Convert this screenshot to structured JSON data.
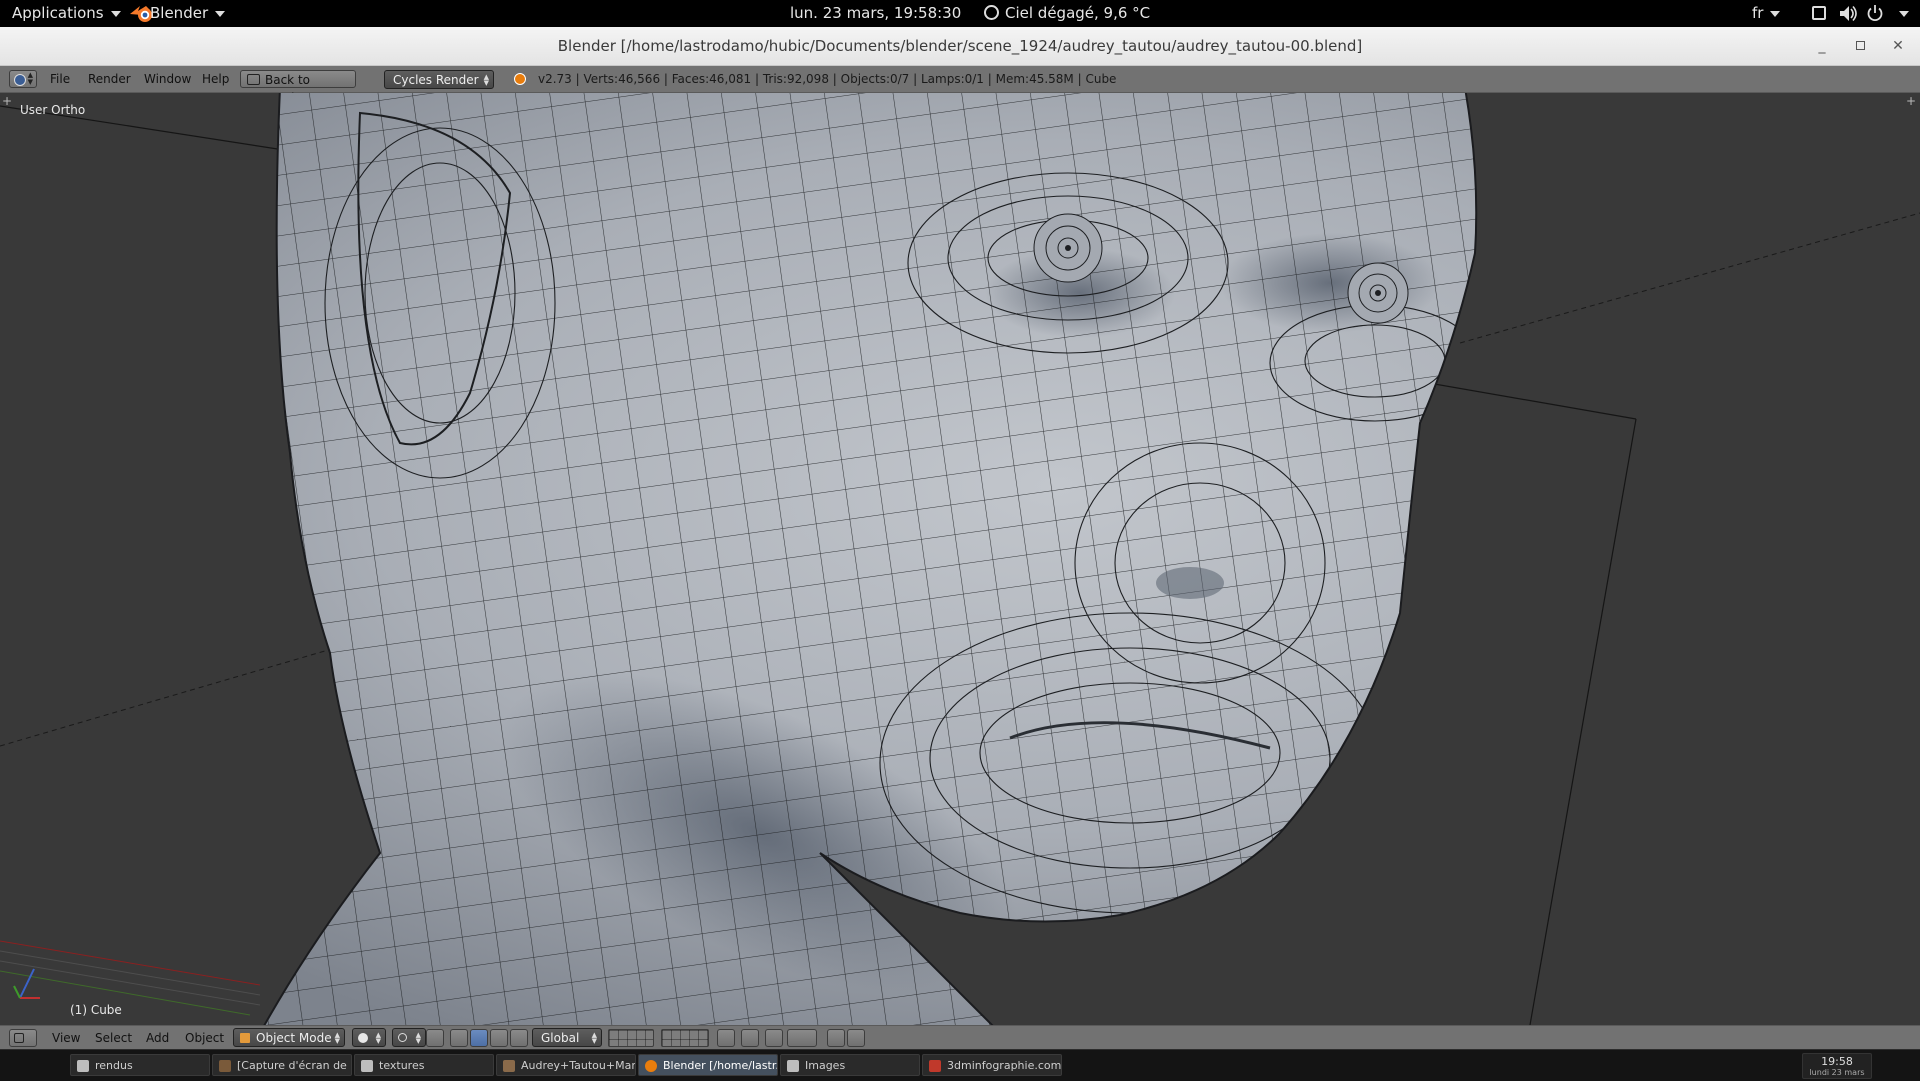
{
  "topbar": {
    "applications": "Applications",
    "app_menu": "Blender",
    "datetime": "lun. 23 mars, 19:58:30",
    "weather": "Ciel dégagé, 9,6 °C",
    "language": "fr",
    "icons": [
      "window-icon",
      "volume-icon",
      "power-icon"
    ]
  },
  "window": {
    "title": "Blender [/home/lastrodamo/hubic/Documents/blender/scene_1924/audrey_tautou/audrey_tautou-00.blend]",
    "buttons": [
      "minimize",
      "maximize",
      "close"
    ]
  },
  "info_header": {
    "menus": [
      "File",
      "Render",
      "Window",
      "Help"
    ],
    "back_button": "Back to Previous",
    "render_engine": "Cycles Render",
    "stats": "v2.73 | Verts:46,566 | Faces:46,081 | Tris:92,098 | Objects:0/7 | Lamps:0/1 | Mem:45.58M | Cube"
  },
  "viewport": {
    "view_name": "User Ortho",
    "active_object": "(1) Cube",
    "background_color": "#393939",
    "mesh_color": "#a3a8b0"
  },
  "view3d_header": {
    "menus": [
      "View",
      "Select",
      "Add",
      "Object"
    ],
    "mode": "Object Mode",
    "orientation": "Global"
  },
  "taskbar": {
    "tasks": [
      {
        "label": "rendus",
        "active": false
      },
      {
        "label": "[Capture d'écran de ...",
        "active": false
      },
      {
        "label": "textures",
        "active": false
      },
      {
        "label": "Audrey+Tautou+Mar...",
        "active": false
      },
      {
        "label": "Blender [/home/lastr...",
        "active": true
      },
      {
        "label": "Images",
        "active": false
      },
      {
        "label": "3dminfographie.com...",
        "active": false
      }
    ],
    "clock_time": "19:58",
    "clock_date": "lundi 23 mars"
  }
}
